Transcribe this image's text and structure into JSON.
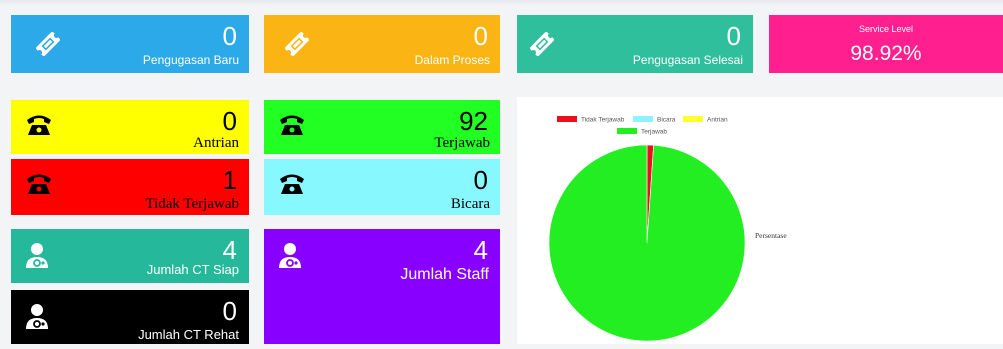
{
  "summary": {
    "baru": {
      "value": "0",
      "label": "Pengugasan Baru",
      "color": "#2ba9e8"
    },
    "proses": {
      "value": "0",
      "label": "Dalam Proses",
      "color": "#fab514"
    },
    "selesai": {
      "value": "0",
      "label": "Pengugasan Selesai",
      "color": "#2fbf9c"
    },
    "service": {
      "title": "Service Level",
      "value": "98.92%",
      "color": "#ff1f8f"
    }
  },
  "calls": {
    "antrian": {
      "value": "0",
      "label": "Antrian",
      "color": "#ffff00"
    },
    "terjawab": {
      "value": "92",
      "label": "Terjawab",
      "color": "#22ff22"
    },
    "tidak_terjawab": {
      "value": "1",
      "label": "Tidak Terjawab",
      "color": "#ff0000"
    },
    "bicara": {
      "value": "0",
      "label": "Bicara",
      "color": "#88f8ff"
    }
  },
  "staff": {
    "ct_siap": {
      "value": "4",
      "label": "Jumlah CT Siap",
      "color": "#25b89a"
    },
    "staff": {
      "value": "4",
      "label": "Jumlah Staff",
      "color": "#8800ff"
    },
    "ct_rehat": {
      "value": "0",
      "label": "Jumlah CT Rehat",
      "color": "#000000"
    }
  },
  "icons": {
    "ticket": "ticket-icon",
    "phone": "phone-icon",
    "agent": "agent-icon"
  },
  "chart_data": {
    "type": "pie",
    "title": "",
    "side_label": "Persentase",
    "legend_position": "top",
    "series": [
      {
        "name": "Tidak Terjawab",
        "value": 1,
        "color": "#e8101a"
      },
      {
        "name": "Bicara",
        "value": 0,
        "color": "#8ef3ff"
      },
      {
        "name": "Antrian",
        "value": 0,
        "color": "#ffff30"
      },
      {
        "name": "Terjawab",
        "value": 92,
        "color": "#22ee22"
      }
    ]
  }
}
